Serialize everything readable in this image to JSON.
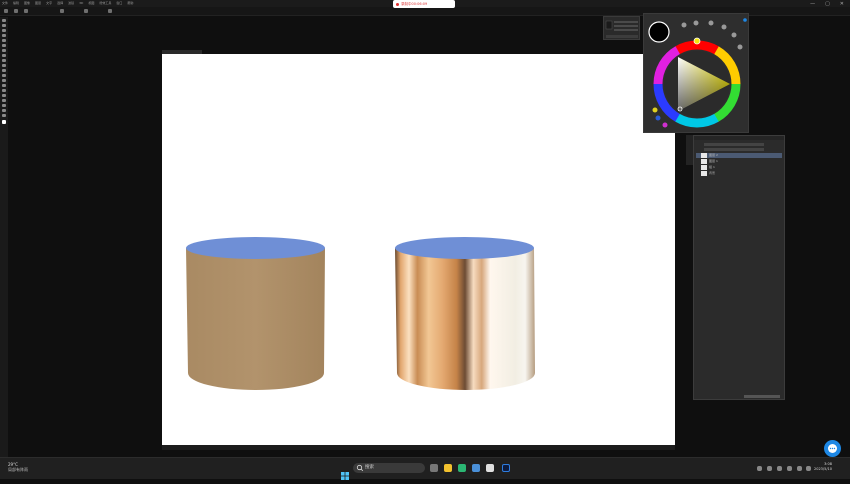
{
  "menubar": {
    "items": [
      "文件",
      "编辑",
      "图像",
      "图层",
      "文字",
      "选择",
      "滤镜",
      "3D",
      "视图",
      "增效工具",
      "窗口",
      "帮助"
    ]
  },
  "recording": {
    "label": "录制中00:06:09"
  },
  "window_controls": {
    "minimize": "—",
    "restore": "▢",
    "close": "✕"
  },
  "layers_panel": {
    "layers": [
      {
        "name": "图层 2",
        "selected": true
      },
      {
        "name": "图层 1",
        "selected": false
      },
      {
        "name": "组 1",
        "selected": false
      },
      {
        "name": "背景",
        "selected": false
      }
    ]
  },
  "taskbar": {
    "weather": {
      "temp": "29°C",
      "desc": "局部有阵雨"
    },
    "search_placeholder": "搜索",
    "clock": {
      "time": "3:08",
      "date": "2023/5/10"
    }
  },
  "colors": {
    "foreground": "#000000",
    "accent": "#1e88e5",
    "cylinder_top": "#6f8fd6"
  }
}
